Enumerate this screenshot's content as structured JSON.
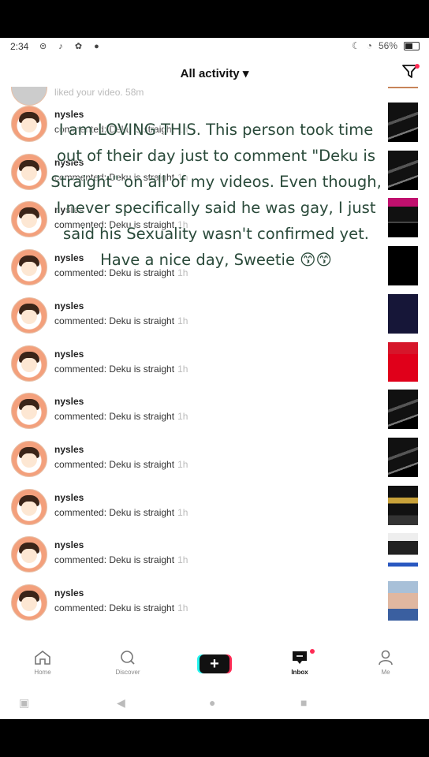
{
  "status": {
    "time": "2:34",
    "battery": "56%",
    "notifications": "⊜ ♪ ✿ ●"
  },
  "header": {
    "title": "All activity ▾"
  },
  "partial_row": {
    "text": "liked your video. 58m"
  },
  "rows": [
    {
      "user": "nysles",
      "action": "commented: Deku is straight",
      "time": "1h",
      "thumb": "dark-collage"
    },
    {
      "user": "nysles",
      "action": "commented: Deku is straight",
      "time": "1h",
      "thumb": "dark-collage"
    },
    {
      "user": "nysles",
      "action": "commented: Deku is straight",
      "time": "1h",
      "thumb": "dark-magenta"
    },
    {
      "user": "nysles",
      "action": "commented: Deku is straight",
      "time": "1h",
      "thumb": "black"
    },
    {
      "user": "nysles",
      "action": "commented: Deku is straight",
      "time": "1h",
      "thumb": "navy"
    },
    {
      "user": "nysles",
      "action": "commented: Deku is straight",
      "time": "1h",
      "thumb": "red"
    },
    {
      "user": "nysles",
      "action": "commented: Deku is straight",
      "time": "1h",
      "thumb": "dark-collage"
    },
    {
      "user": "nysles",
      "action": "commented: Deku is straight",
      "time": "1h",
      "thumb": "dark-collage"
    },
    {
      "user": "nysles",
      "action": "commented: Deku is straight",
      "time": "1h",
      "thumb": "dark-yellow"
    },
    {
      "user": "nysles",
      "action": "commented: Deku is straight",
      "time": "1h",
      "thumb": "light-anime"
    },
    {
      "user": "nysles",
      "action": "commented: Deku is straight",
      "time": "1h",
      "thumb": "selfie"
    }
  ],
  "caption": "I am LOVING THIS. This person took time out of their day just to comment \"Deku is Straight\" on all of my videos. Even though, I never specifically said he was gay, I just said his Sexuality wasn't confirmed yet. Have a nice day, Sweetie 😙😙",
  "nav": {
    "home": "Home",
    "discover": "Discover",
    "inbox": "Inbox",
    "me": "Me"
  },
  "colors": {
    "accent": "#fe2c55",
    "cyan": "#25f4ee",
    "caption": "#2a4a3a"
  }
}
